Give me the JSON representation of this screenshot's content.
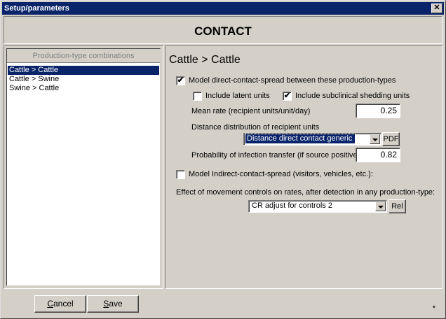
{
  "window": {
    "title": "Setup/parameters",
    "close_label": "✕"
  },
  "header": {
    "title": "CONTACT"
  },
  "sidebar": {
    "header": "Production-type combinations",
    "items": [
      {
        "label": "Cattle > Cattle",
        "selected": true
      },
      {
        "label": "Cattle > Swine",
        "selected": false
      },
      {
        "label": "Swine > Cattle",
        "selected": false
      }
    ]
  },
  "main": {
    "section_title": "Cattle > Cattle",
    "direct_contact": {
      "label": "Model direct-contact-spread between these production-types",
      "checked": true,
      "check_glyph": "✔"
    },
    "latent_units": {
      "label": "Include latent units",
      "checked": false
    },
    "subclinical_units": {
      "label": "Include subclinical shedding units",
      "checked": true,
      "check_glyph": "✔"
    },
    "mean_rate": {
      "label": "Mean rate (recipient units/unit/day)",
      "value": "0.25"
    },
    "distance_distribution": {
      "label": "Distance distribution of recipient units",
      "selected": "Distance direct contact generic",
      "button_label": "PDF"
    },
    "infection_transfer": {
      "label": "Probability of infection transfer (if source positive)",
      "value": "0.82"
    },
    "indirect_contact": {
      "label": "Model Indirect-contact-spread (visitors, vehicles, etc.):",
      "checked": false
    },
    "movement_controls": {
      "label": "Effect of movement controls on rates, after detection in any production-type:",
      "selected": "CR adjust for controls 2",
      "button_label": "Rel"
    }
  },
  "footer": {
    "cancel": {
      "underline": "C",
      "rest": "ancel"
    },
    "save": {
      "underline": "S",
      "rest": "ave"
    },
    "star": "*"
  }
}
